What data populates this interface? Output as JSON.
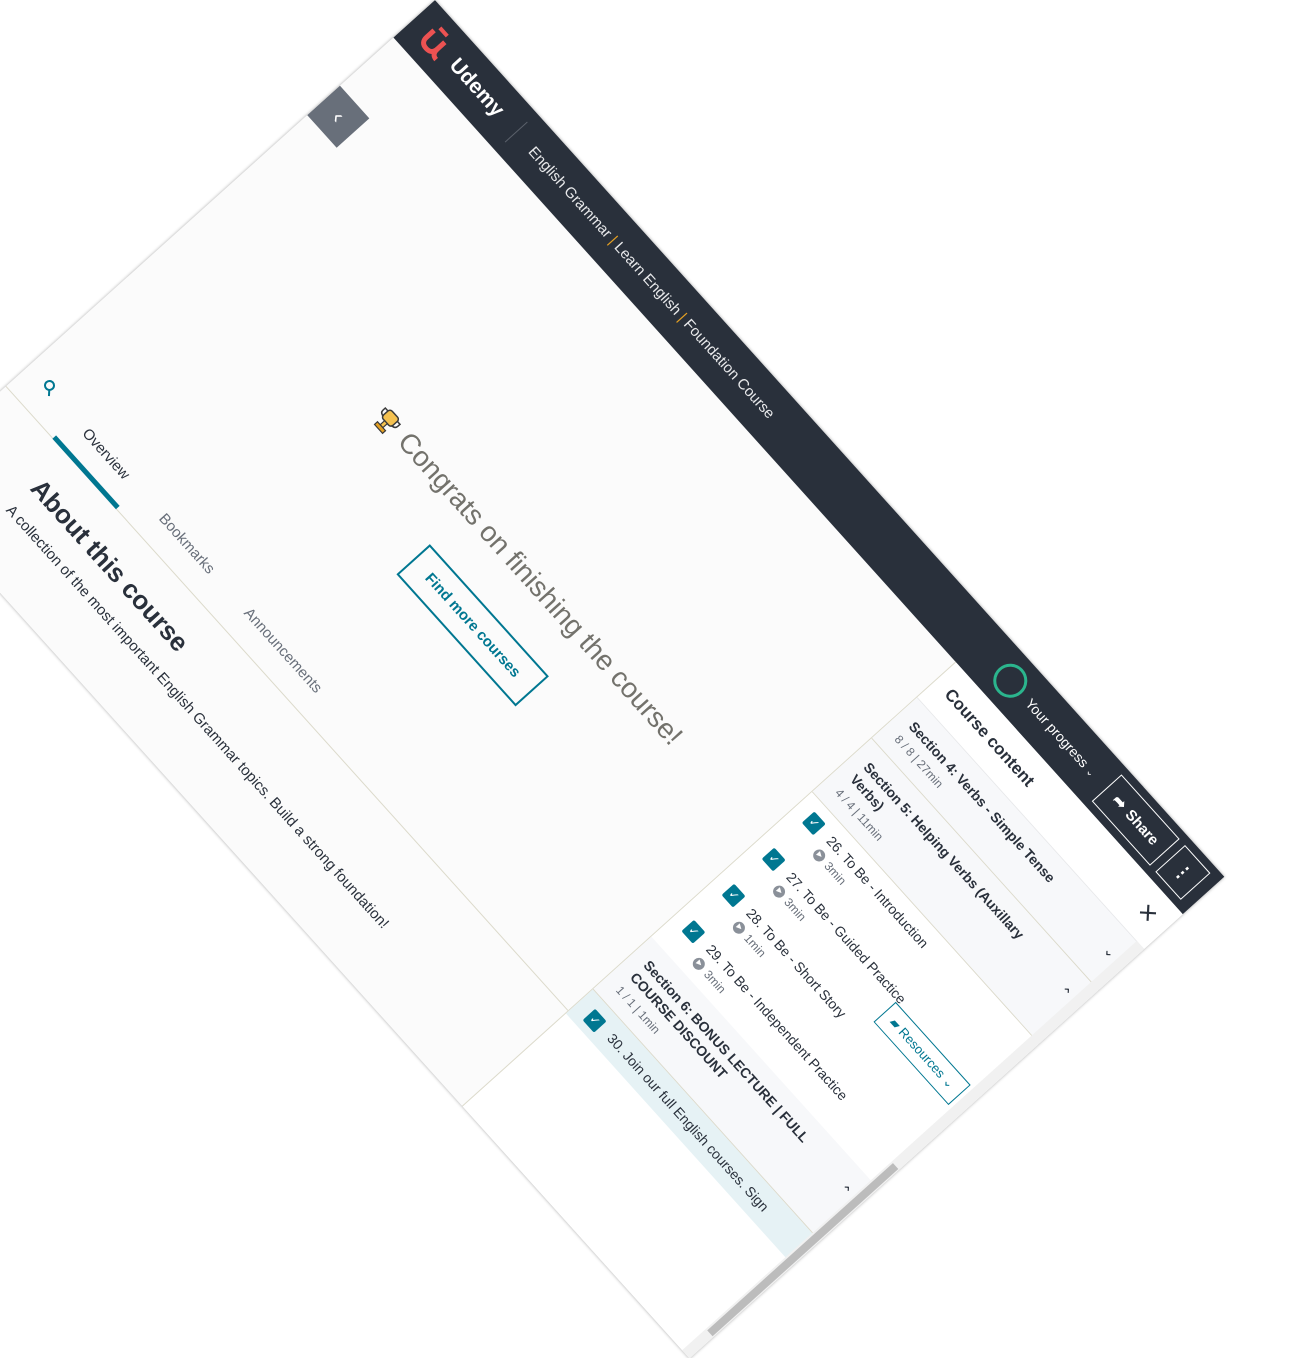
{
  "brand": {
    "name": "Udemy",
    "colors": {
      "bar": "#29303b",
      "accent": "#007791",
      "logo": "#ec5252",
      "progress": "#2bb58d"
    }
  },
  "header": {
    "course_title_parts": [
      "English Grammar",
      "Learn English",
      "Foundation Course"
    ],
    "progress_label": "Your progress",
    "share_label": "Share"
  },
  "congrats": {
    "message": "Congrats on finishing the course!",
    "button": "Find more courses"
  },
  "tabs": [
    "Overview",
    "Bookmarks",
    "Announcements"
  ],
  "about": {
    "heading": "About this course",
    "text": "A collection of the most important English Grammar topics. Build a strong foundation!"
  },
  "sidebar": {
    "title": "Course content",
    "sections": [
      {
        "title": "Section 4: Verbs - Simple Tense",
        "meta": "8 / 8 | 27min"
      },
      {
        "title": "Section 5: Helping Verbs (Auxillary Verbs)",
        "meta": "4 / 4 | 11min"
      },
      {
        "title": "Section 6: BONUS LECTURE | FULL COURSE DISCOUNT",
        "meta": "1 / 1 | 1min"
      }
    ],
    "lectures": [
      {
        "title": "26. To Be - Introduction",
        "duration": "3min"
      },
      {
        "title": "27. To Be - Guided Practice",
        "duration": "3min"
      },
      {
        "title": "28. To Be - Short Story",
        "duration": "1min"
      },
      {
        "title": "29. To Be - Independent Practice",
        "duration": "3min"
      },
      {
        "title": "30. Join our full English courses. Sign"
      }
    ],
    "resources_label": "Resources"
  }
}
